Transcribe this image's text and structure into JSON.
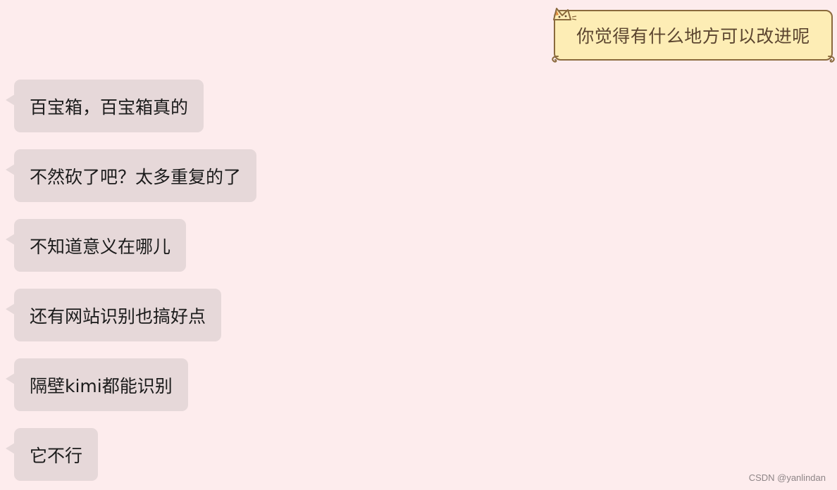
{
  "sent": {
    "text": "你觉得有什么地方可以改进呢"
  },
  "received": [
    {
      "text": "百宝箱，百宝箱真的"
    },
    {
      "text": "不然砍了吧？太多重复的了"
    },
    {
      "text": "不知道意义在哪儿"
    },
    {
      "text": "还有网站识别也搞好点"
    },
    {
      "text": "隔壁kimi都能识别"
    },
    {
      "text": "它不行"
    }
  ],
  "watermark": "CSDN @yanlindan",
  "colors": {
    "background": "#fdeced",
    "received_bubble": "#e6d8d9",
    "sent_bubble": "#fdedb5",
    "sent_border": "#8a6a3d"
  }
}
